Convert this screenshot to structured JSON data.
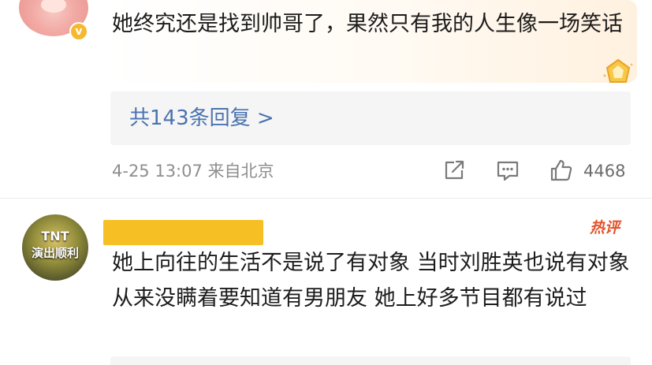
{
  "comments": [
    {
      "text": "她终究还是找到帅哥了，果然只有我的人生像一场笑话",
      "verified_mark": "v",
      "replies_link": "共143条回复 >",
      "meta": "4-25 13:07 来自北京",
      "like_count": "4468",
      "icons": [
        "share-icon",
        "comment-icon",
        "like-icon",
        "medal-icon"
      ]
    },
    {
      "avatar_line1": "TNT",
      "avatar_line2": "演出顺利",
      "hot_tag": "热评",
      "text": "她上向往的生活不是说了有对象 当时刘胜英也说有对象从来没瞒着要知道有男朋友 她上好多节目都有说过"
    }
  ],
  "colors": {
    "link": "#4a73b0",
    "meta": "#8e8e8e",
    "hot": "#e4532b",
    "redaction": "#f6c025",
    "verified": "#f5b82e"
  }
}
